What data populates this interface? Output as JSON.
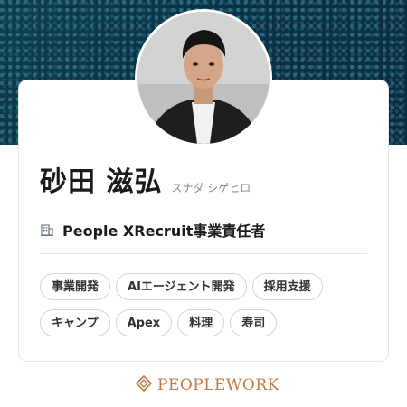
{
  "profile": {
    "name": "砂田 滋弘",
    "kana": "スナダ シゲヒロ",
    "organization": "People XRecruit事業責任者",
    "tags": [
      "事業開発",
      "AIエージェント開発",
      "採用支援",
      "キャンプ",
      "Apex",
      "料理",
      "寿司"
    ]
  },
  "footer": {
    "brand": "PEOPLEWORK"
  },
  "colors": {
    "header_bg": "#0b2f45",
    "brand": "#c07a45"
  },
  "icons": {
    "organization": "building-icon",
    "brand_logo": "peoplework-logo-icon"
  }
}
